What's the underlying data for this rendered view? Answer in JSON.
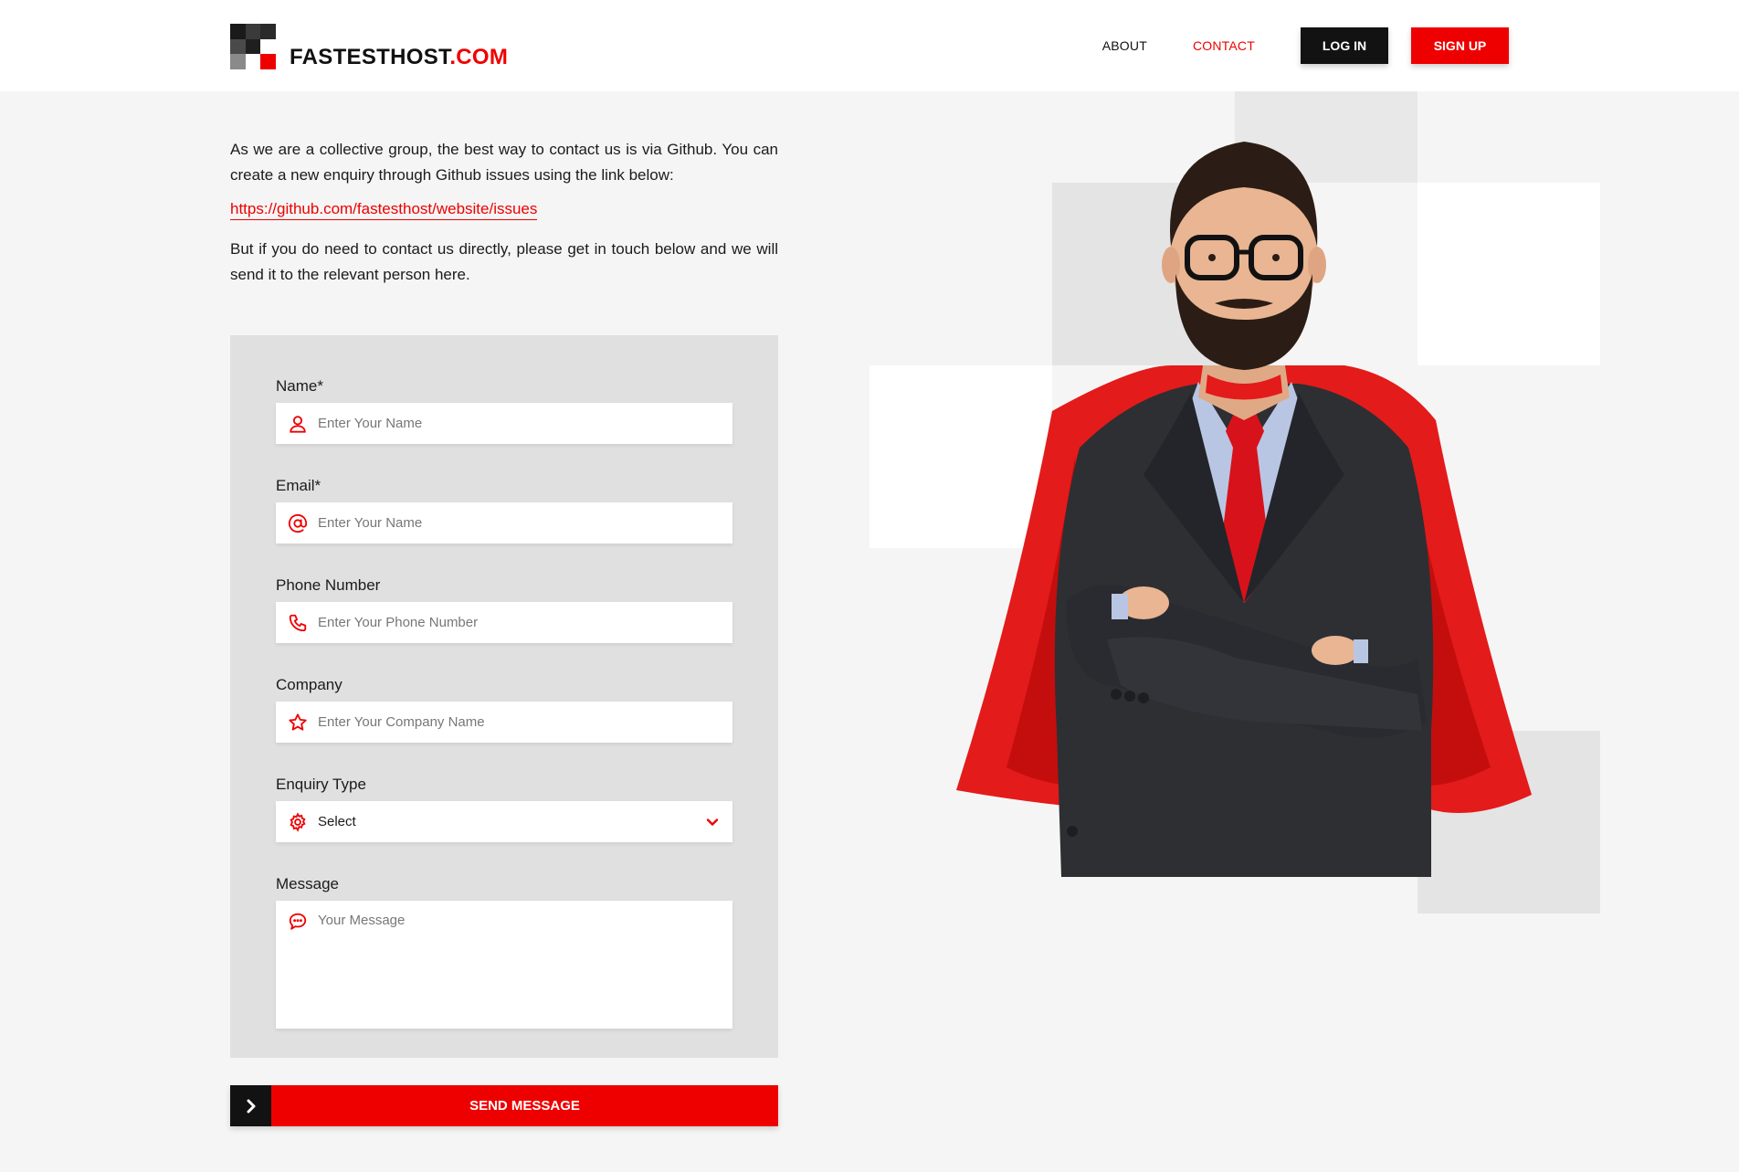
{
  "header": {
    "logo_text": "FASTESTHOST",
    "logo_suffix": ".COM",
    "nav": {
      "about": "ABOUT",
      "contact": "CONTACT"
    },
    "login_label": "LOG IN",
    "signup_label": "SIGN UP"
  },
  "intro": {
    "paragraph1": "As we are a collective group, the best way to contact us is via Github. You can create a new enquiry through Github issues using the link below:",
    "link": "https://github.com/fastesthost/website/issues",
    "paragraph2": "But if you do need to contact us directly, please get in touch below and we will send it to the relevant person here."
  },
  "form": {
    "name": {
      "label": "Name*",
      "placeholder": "Enter Your Name",
      "icon": "user-icon"
    },
    "email": {
      "label": "Email*",
      "placeholder": "Enter Your Name",
      "icon": "at-icon"
    },
    "phone": {
      "label": "Phone Number",
      "placeholder": "Enter Your Phone Number",
      "icon": "phone-icon"
    },
    "company": {
      "label": "Company",
      "placeholder": "Enter Your Company Name",
      "icon": "star-icon"
    },
    "enquiry": {
      "label": "Enquiry Type",
      "value": "Select",
      "icon": "gear-icon"
    },
    "message": {
      "label": "Message",
      "placeholder": "Your Message",
      "icon": "chat-bubble-icon"
    },
    "send_label": "SEND MESSAGE"
  },
  "colors": {
    "accent": "#ef0000",
    "dark": "#121212",
    "panel": "#e0e0e0",
    "background": "#f5f5f5"
  }
}
